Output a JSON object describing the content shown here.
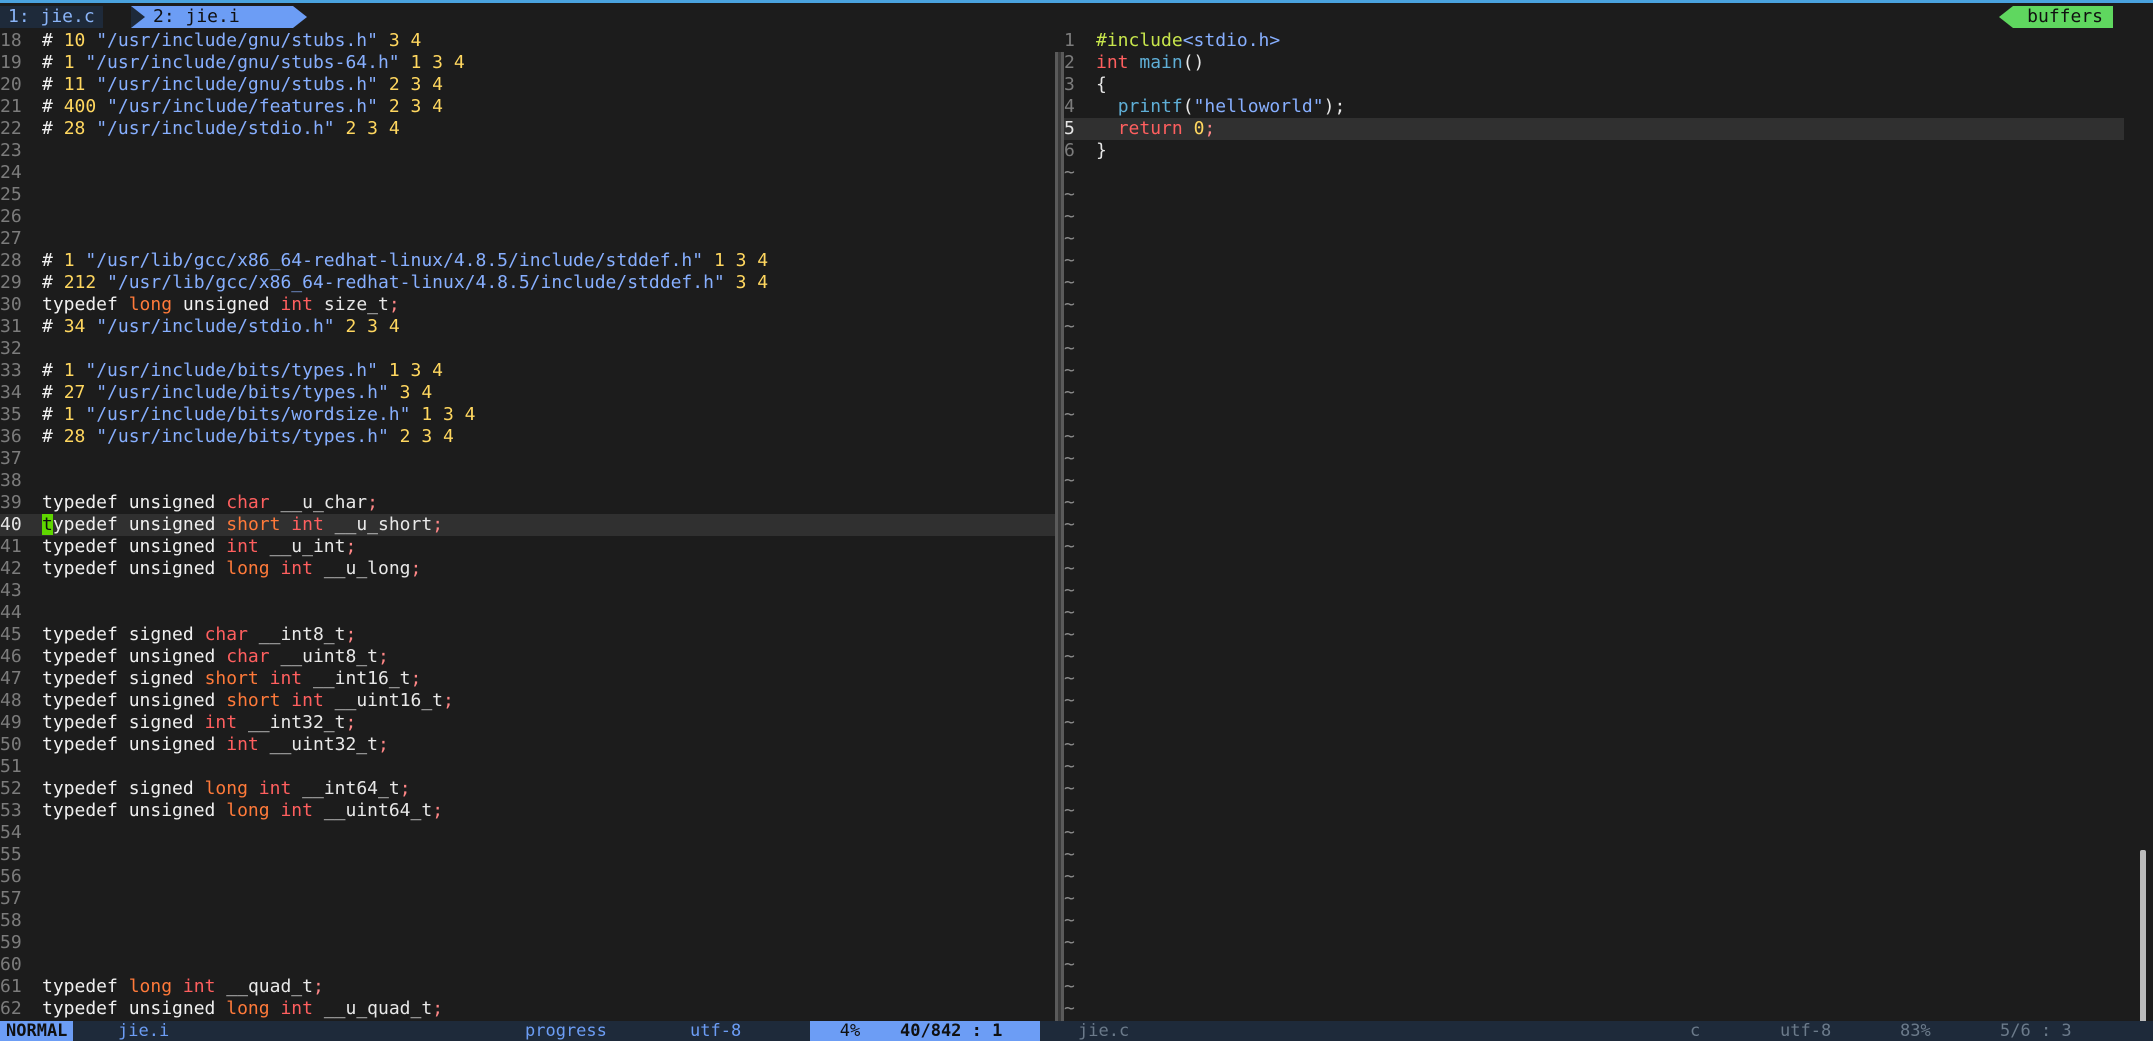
{
  "tabs": [
    {
      "label": "1: jie.c"
    },
    {
      "label": "2: jie.i"
    }
  ],
  "buffers_label": "buffers",
  "left_lines": [
    {
      "n": "18",
      "html": "<span class=\"kw\"># </span><span class=\"num\">10</span> <span class=\"str\">\"/usr/include/gnu/stubs.h\"</span> <span class=\"num\">3 4</span>"
    },
    {
      "n": "19",
      "html": "<span class=\"kw\"># </span><span class=\"num\">1</span> <span class=\"str\">\"/usr/include/gnu/stubs-64.h\"</span> <span class=\"num\">1 3 4</span>"
    },
    {
      "n": "20",
      "html": "<span class=\"kw\"># </span><span class=\"num\">11</span> <span class=\"str\">\"/usr/include/gnu/stubs.h\"</span> <span class=\"num\">2 3 4</span>"
    },
    {
      "n": "21",
      "html": "<span class=\"kw\"># </span><span class=\"num\">400</span> <span class=\"str\">\"/usr/include/features.h\"</span> <span class=\"num\">2 3 4</span>"
    },
    {
      "n": "22",
      "html": "<span class=\"kw\"># </span><span class=\"num\">28</span> <span class=\"str\">\"/usr/include/stdio.h\"</span> <span class=\"num\">2 3 4</span>"
    },
    {
      "n": "23",
      "html": ""
    },
    {
      "n": "24",
      "html": ""
    },
    {
      "n": "25",
      "html": ""
    },
    {
      "n": "26",
      "html": ""
    },
    {
      "n": "27",
      "html": ""
    },
    {
      "n": "28",
      "html": "<span class=\"kw\"># </span><span class=\"num\">1</span> <span class=\"str\">\"/usr/lib/gcc/x86_64-redhat-linux/4.8.5/include/stddef.h\"</span> <span class=\"num\">1 3 4</span>"
    },
    {
      "n": "29",
      "html": "<span class=\"kw\"># </span><span class=\"num\">212</span> <span class=\"str\">\"/usr/lib/gcc/x86_64-redhat-linux/4.8.5/include/stddef.h\"</span> <span class=\"num\">3 4</span>"
    },
    {
      "n": "30",
      "html": "<span class=\"kw\">typedef</span> <span class=\"ty2\">long</span> <span class=\"kw\">unsigned</span> <span class=\"ty\">int</span> <span class=\"plain\">size_t</span><span class=\"punc\">;</span>"
    },
    {
      "n": "31",
      "html": "<span class=\"kw\"># </span><span class=\"num\">34</span> <span class=\"str\">\"/usr/include/stdio.h\"</span> <span class=\"num\">2 3 4</span>"
    },
    {
      "n": "32",
      "html": ""
    },
    {
      "n": "33",
      "html": "<span class=\"kw\"># </span><span class=\"num\">1</span> <span class=\"str\">\"/usr/include/bits/types.h\"</span> <span class=\"num\">1 3 4</span>"
    },
    {
      "n": "34",
      "html": "<span class=\"kw\"># </span><span class=\"num\">27</span> <span class=\"str\">\"/usr/include/bits/types.h\"</span> <span class=\"num\">3 4</span>"
    },
    {
      "n": "35",
      "html": "<span class=\"kw\"># </span><span class=\"num\">1</span> <span class=\"str\">\"/usr/include/bits/wordsize.h\"</span> <span class=\"num\">1 3 4</span>"
    },
    {
      "n": "36",
      "html": "<span class=\"kw\"># </span><span class=\"num\">28</span> <span class=\"str\">\"/usr/include/bits/types.h\"</span> <span class=\"num\">2 3 4</span>"
    },
    {
      "n": "37",
      "html": ""
    },
    {
      "n": "38",
      "html": ""
    },
    {
      "n": "39",
      "html": "<span class=\"kw\">typedef</span> <span class=\"kw\">unsigned</span> <span class=\"ty\">char</span> <span class=\"plain\">__u_char</span><span class=\"punc\">;</span>"
    },
    {
      "n": "40",
      "cur": true,
      "html": "<span class=\"cursor\">t</span><span class=\"kw\">ypedef</span> <span class=\"kw\">unsigned</span> <span class=\"ty2\">short</span> <span class=\"ty\">int</span> <span class=\"plain\">__u_short</span><span class=\"punc\">;</span>"
    },
    {
      "n": "41",
      "html": "<span class=\"kw\">typedef</span> <span class=\"kw\">unsigned</span> <span class=\"ty\">int</span> <span class=\"plain\">__u_int</span><span class=\"punc\">;</span>"
    },
    {
      "n": "42",
      "html": "<span class=\"kw\">typedef</span> <span class=\"kw\">unsigned</span> <span class=\"ty2\">long</span> <span class=\"ty\">int</span> <span class=\"plain\">__u_long</span><span class=\"punc\">;</span>"
    },
    {
      "n": "43",
      "html": ""
    },
    {
      "n": "44",
      "html": ""
    },
    {
      "n": "45",
      "html": "<span class=\"kw\">typedef</span> <span class=\"kw\">signed</span> <span class=\"ty\">char</span> <span class=\"plain\">__int8_t</span><span class=\"punc\">;</span>"
    },
    {
      "n": "46",
      "html": "<span class=\"kw\">typedef</span> <span class=\"kw\">unsigned</span> <span class=\"ty\">char</span> <span class=\"plain\">__uint8_t</span><span class=\"punc\">;</span>"
    },
    {
      "n": "47",
      "html": "<span class=\"kw\">typedef</span> <span class=\"kw\">signed</span> <span class=\"ty2\">short</span> <span class=\"ty\">int</span> <span class=\"plain\">__int16_t</span><span class=\"punc\">;</span>"
    },
    {
      "n": "48",
      "html": "<span class=\"kw\">typedef</span> <span class=\"kw\">unsigned</span> <span class=\"ty2\">short</span> <span class=\"ty\">int</span> <span class=\"plain\">__uint16_t</span><span class=\"punc\">;</span>"
    },
    {
      "n": "49",
      "html": "<span class=\"kw\">typedef</span> <span class=\"kw\">signed</span> <span class=\"ty\">int</span> <span class=\"plain\">__int32_t</span><span class=\"punc\">;</span>"
    },
    {
      "n": "50",
      "html": "<span class=\"kw\">typedef</span> <span class=\"kw\">unsigned</span> <span class=\"ty\">int</span> <span class=\"plain\">__uint32_t</span><span class=\"punc\">;</span>"
    },
    {
      "n": "51",
      "html": ""
    },
    {
      "n": "52",
      "html": "<span class=\"kw\">typedef</span> <span class=\"kw\">signed</span> <span class=\"ty2\">long</span> <span class=\"ty\">int</span> <span class=\"plain\">__int64_t</span><span class=\"punc\">;</span>"
    },
    {
      "n": "53",
      "html": "<span class=\"kw\">typedef</span> <span class=\"kw\">unsigned</span> <span class=\"ty2\">long</span> <span class=\"ty\">int</span> <span class=\"plain\">__uint64_t</span><span class=\"punc\">;</span>"
    },
    {
      "n": "54",
      "html": ""
    },
    {
      "n": "55",
      "html": ""
    },
    {
      "n": "56",
      "html": ""
    },
    {
      "n": "57",
      "html": ""
    },
    {
      "n": "58",
      "html": ""
    },
    {
      "n": "59",
      "html": ""
    },
    {
      "n": "60",
      "html": ""
    },
    {
      "n": "61",
      "html": "<span class=\"kw\">typedef</span> <span class=\"ty2\">long</span> <span class=\"ty\">int</span> <span class=\"plain\">__quad_t</span><span class=\"punc\">;</span>"
    },
    {
      "n": "62",
      "html": "<span class=\"kw\">typedef</span> <span class=\"kw\">unsigned</span> <span class=\"ty2\">long</span> <span class=\"ty\">int</span> <span class=\"plain\">__u_quad_t</span><span class=\"punc\">;</span>"
    }
  ],
  "right_lines": [
    {
      "n": "1",
      "html": "<span class=\"pre\">#include</span><span class=\"inc\">&lt;stdio.h&gt;</span>"
    },
    {
      "n": "2",
      "html": "<span class=\"ty\">int</span> <span class=\"fn\">main</span><span class=\"plain\">()</span>"
    },
    {
      "n": "3",
      "html": "<span class=\"plain\">{</span>"
    },
    {
      "n": "4",
      "html": "  <span class=\"fn\">printf</span><span class=\"plain\">(</span><span class=\"str\">\"helloworld\"</span><span class=\"plain\">);</span>"
    },
    {
      "n": "5",
      "cur": true,
      "html": "  <span class=\"ty\">return</span> <span class=\"num\">0</span><span class=\"punc\">;</span>"
    },
    {
      "n": "6",
      "html": "<span class=\"plain\">}</span>"
    }
  ],
  "tilde_count": 39,
  "status": {
    "mode": "NORMAL",
    "file": "jie.i",
    "progress": "progress",
    "encoding": "utf-8",
    "percent": "4%",
    "position": "40/842 :  1",
    "right_file": "jie.c",
    "right_filetype": "c",
    "right_encoding": "utf-8",
    "right_percent": "83%",
    "right_position": "5/6 :  3"
  }
}
